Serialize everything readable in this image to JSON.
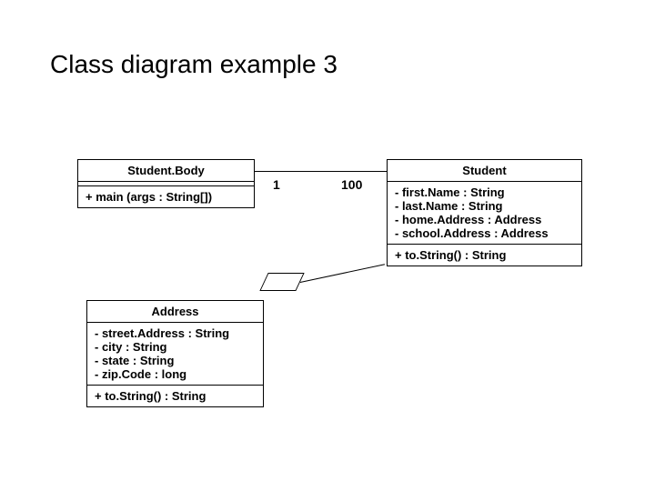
{
  "title": "Class diagram example 3",
  "classes": {
    "studentBody": {
      "name": "Student.Body",
      "methods": [
        "+ main (args : String[])"
      ]
    },
    "student": {
      "name": "Student",
      "attrs": [
        "- first.Name : String",
        "- last.Name : String",
        "- home.Address : Address",
        "- school.Address : Address"
      ],
      "methods": [
        "+ to.String() : String"
      ]
    },
    "address": {
      "name": "Address",
      "attrs": [
        "- street.Address : String",
        "- city : String",
        "- state : String",
        "- zip.Code : long"
      ],
      "methods": [
        "+ to.String() : String"
      ]
    }
  },
  "multiplicity": {
    "left": "1",
    "right": "100"
  }
}
